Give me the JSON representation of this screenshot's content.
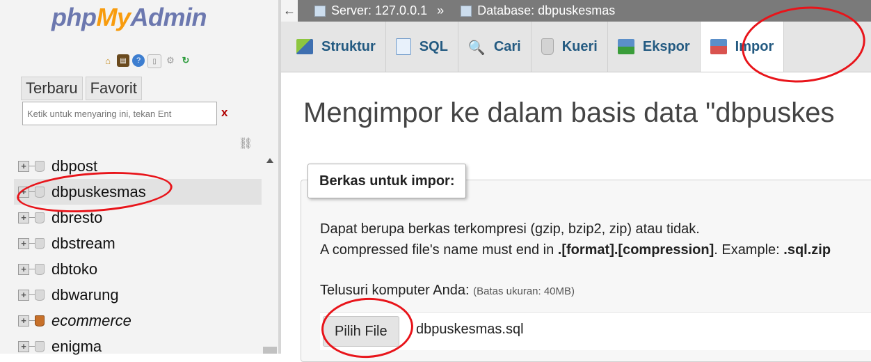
{
  "colors": {
    "logo_primary": "#6c78af",
    "logo_accent": "#f89c0e",
    "tab_text": "#235a81",
    "annotation_red": "#e8141a",
    "topbar_bg": "#7a7a7a"
  },
  "logo": {
    "part1": "php",
    "part2": "My",
    "part3": "Admin"
  },
  "nav_icons": [
    "home-icon",
    "database-icon",
    "help-icon",
    "docs-icon",
    "settings-icon",
    "reload-icon"
  ],
  "left_tabs": [
    "Terbaru",
    "Favorit"
  ],
  "filter": {
    "placeholder": "Ketik untuk menyaring ini, tekan Ent",
    "clear": "x"
  },
  "databases": [
    {
      "name": "dbpost"
    },
    {
      "name": "dbpuskesmas",
      "active": true
    },
    {
      "name": "dbresto"
    },
    {
      "name": "dbstream"
    },
    {
      "name": "dbtoko"
    },
    {
      "name": "dbwarung"
    },
    {
      "name": "ecommerce",
      "italic": true
    },
    {
      "name": "enigma"
    }
  ],
  "breadcrumb": {
    "back": "←",
    "server": "Server: 127.0.0.1",
    "separator": "»",
    "database": "Database: dbpuskesmas"
  },
  "tabs": [
    "Struktur",
    "SQL",
    "Cari",
    "Kueri",
    "Ekspor",
    "Impor"
  ],
  "active_tab": "Impor",
  "page_title": "Mengimpor ke dalam basis data \"dbpuskes",
  "import_section": {
    "legend": "Berkas untuk impor:",
    "desc1": "Dapat berupa berkas terkompresi (gzip, bzip2, zip) atau tidak.",
    "desc2_pre": "A compressed file's name must end in ",
    "desc2_bold": ".[format].[compression]",
    "desc2_mid": ". Example: ",
    "desc2_example": ".sql.zip",
    "browse_label": "Telusuri komputer Anda:",
    "browse_note": "(Batas ukuran: 40MB)",
    "choose_button": "Pilih File",
    "file_name": "dbpuskesmas.sql"
  }
}
